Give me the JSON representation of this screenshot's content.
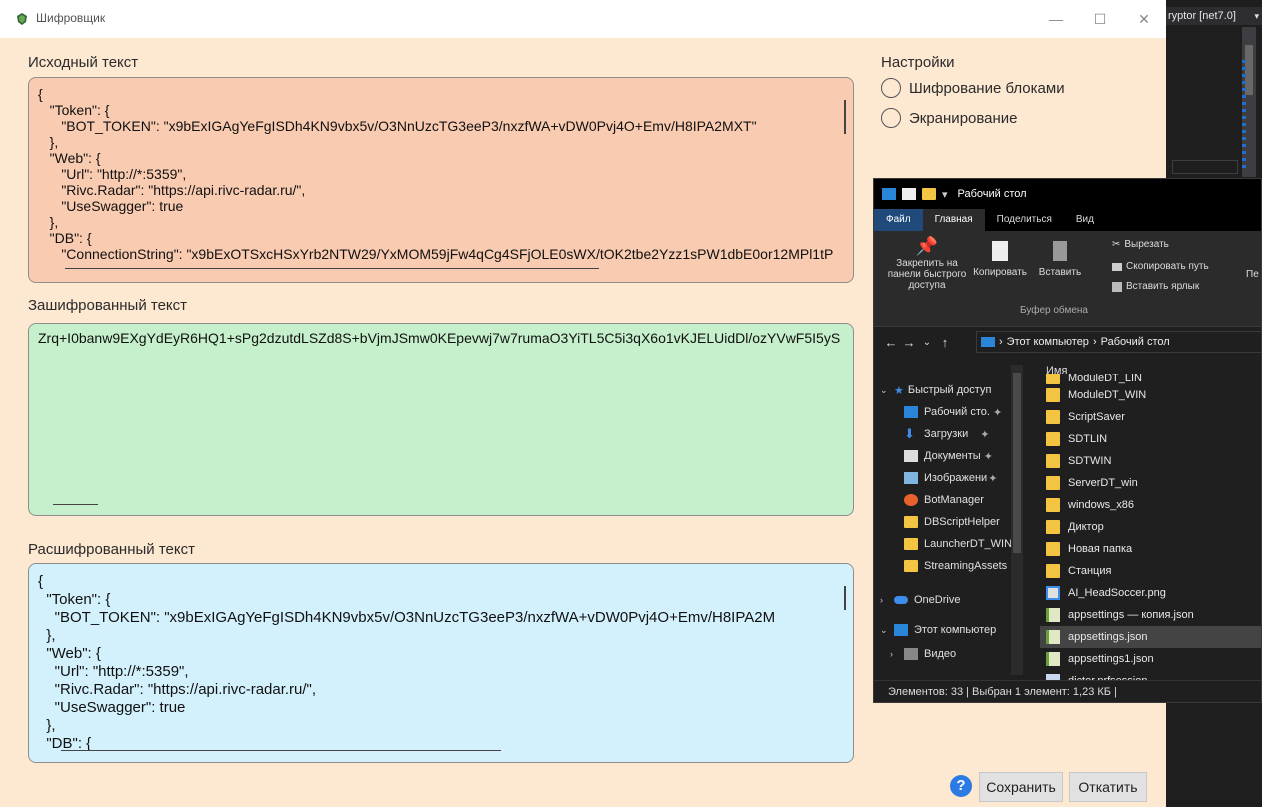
{
  "window": {
    "title": "Шифровщик",
    "controls": {
      "minimize": "—",
      "maximize": "☐",
      "close": "✕"
    }
  },
  "background_ide": {
    "tab_label": "ryptor [net7.0]"
  },
  "source": {
    "label": "Исходный текст",
    "text": "{\n   \"Token\": {\n      \"BOT_TOKEN\": \"x9bExIGAgYeFgISDh4KN9vbx5v/O3NnUzcTG3eeP3/nxzfWA+vDW0Pvj4O+Emv/H8IPA2MXT\"\n   },\n   \"Web\": {\n      \"Url\": \"http://*:5359\",\n      \"Rivc.Radar\": \"https://api.rivc-radar.ru/\",\n      \"UseSwagger\": true\n   },\n   \"DB\": {\n      \"ConnectionString\": \"x9bExOTSxcHSxYrb2NTW29/YxMOM59jFw4qCg4SFjOLE0sWX/tOK2tbe2Yzz1sPW1dbE0or12MPl1tP"
  },
  "encrypted": {
    "label": "Зашифрованный текст",
    "text": "Zrq+I0banw9EXgYdEyR6HQ1+sPg2dzutdLSZd8S+bVjmJSmw0KEpevwj7w7rumaO3YiTL5C5i3qX6o1vKJELUidDl/ozYVwF5I5yS"
  },
  "decrypted": {
    "label": "Расшифрованный текст",
    "text": "{\n  \"Token\": {\n    \"BOT_TOKEN\": \"x9bExIGAgYeFgISDh4KN9vbx5v/O3NnUzcTG3eeP3/nxzfWA+vDW0Pvj4O+Emv/H8IPA2M\n  },\n  \"Web\": {\n    \"Url\": \"http://*:5359\",\n    \"Rivc.Radar\": \"https://api.rivc-radar.ru/\",\n    \"UseSwagger\": true\n  },\n  \"DB\": {"
  },
  "settings": {
    "title": "Настройки",
    "options": [
      {
        "label": "Шифрование блоками",
        "checked": false
      },
      {
        "label": "Экранирование",
        "checked": false
      }
    ]
  },
  "footer": {
    "help": "?",
    "save": "Сохранить",
    "rollback": "Откатить"
  },
  "explorer": {
    "title": "Рабочий стол",
    "tabs": [
      "Файл",
      "Главная",
      "Поделиться",
      "Вид"
    ],
    "ribbon": {
      "pin": "Закрепить на панели быстрого доступа",
      "copy": "Копировать",
      "paste": "Вставить",
      "cut": "Вырезать",
      "copy_path": "Скопировать путь",
      "paste_shortcut": "Вставить ярлык",
      "group": "Буфер обмена",
      "more": "Пе"
    },
    "address": {
      "computer": "Этот компьютер",
      "sep": "›",
      "folder": "Рабочий стол"
    },
    "nav": [
      {
        "label": "Быстрый доступ",
        "icon": "star-icon"
      },
      {
        "label": "Рабочий сто.",
        "icon": "desktop-icon"
      },
      {
        "label": "Загрузки",
        "icon": "download-icon"
      },
      {
        "label": "Документы",
        "icon": "documents-icon"
      },
      {
        "label": "Изображени",
        "icon": "pictures-icon"
      },
      {
        "label": "BotManager",
        "icon": "app-icon"
      },
      {
        "label": "DBScriptHelper",
        "icon": "folder-icon"
      },
      {
        "label": "LauncherDT_WIN",
        "icon": "folder-icon"
      },
      {
        "label": "StreamingAssets",
        "icon": "folder-icon"
      },
      {
        "label": "OneDrive",
        "icon": "cloud-icon"
      },
      {
        "label": "Этот компьютер",
        "icon": "computer-icon"
      },
      {
        "label": "Видео",
        "icon": "video-icon"
      }
    ],
    "column": "Имя",
    "files": [
      {
        "name": "ModuleDT_LIN",
        "type": "folder"
      },
      {
        "name": "ModuleDT_WIN",
        "type": "folder"
      },
      {
        "name": "ScriptSaver",
        "type": "folder"
      },
      {
        "name": "SDTLIN",
        "type": "folder"
      },
      {
        "name": "SDTWIN",
        "type": "folder"
      },
      {
        "name": "ServerDT_win",
        "type": "folder"
      },
      {
        "name": "windows_x86",
        "type": "folder"
      },
      {
        "name": "Диктор",
        "type": "folder"
      },
      {
        "name": "Новая папка",
        "type": "folder"
      },
      {
        "name": "Станция",
        "type": "folder"
      },
      {
        "name": "AI_HeadSoccer.png",
        "type": "image"
      },
      {
        "name": "appsettings — копия.json",
        "type": "json"
      },
      {
        "name": "appsettings.json",
        "type": "json"
      },
      {
        "name": "appsettings1.json",
        "type": "json"
      },
      {
        "name": "dictor.prfsession",
        "type": "file"
      }
    ],
    "status": "Элементов: 33  |  Выбран 1 элемент: 1,23 КБ  |"
  }
}
